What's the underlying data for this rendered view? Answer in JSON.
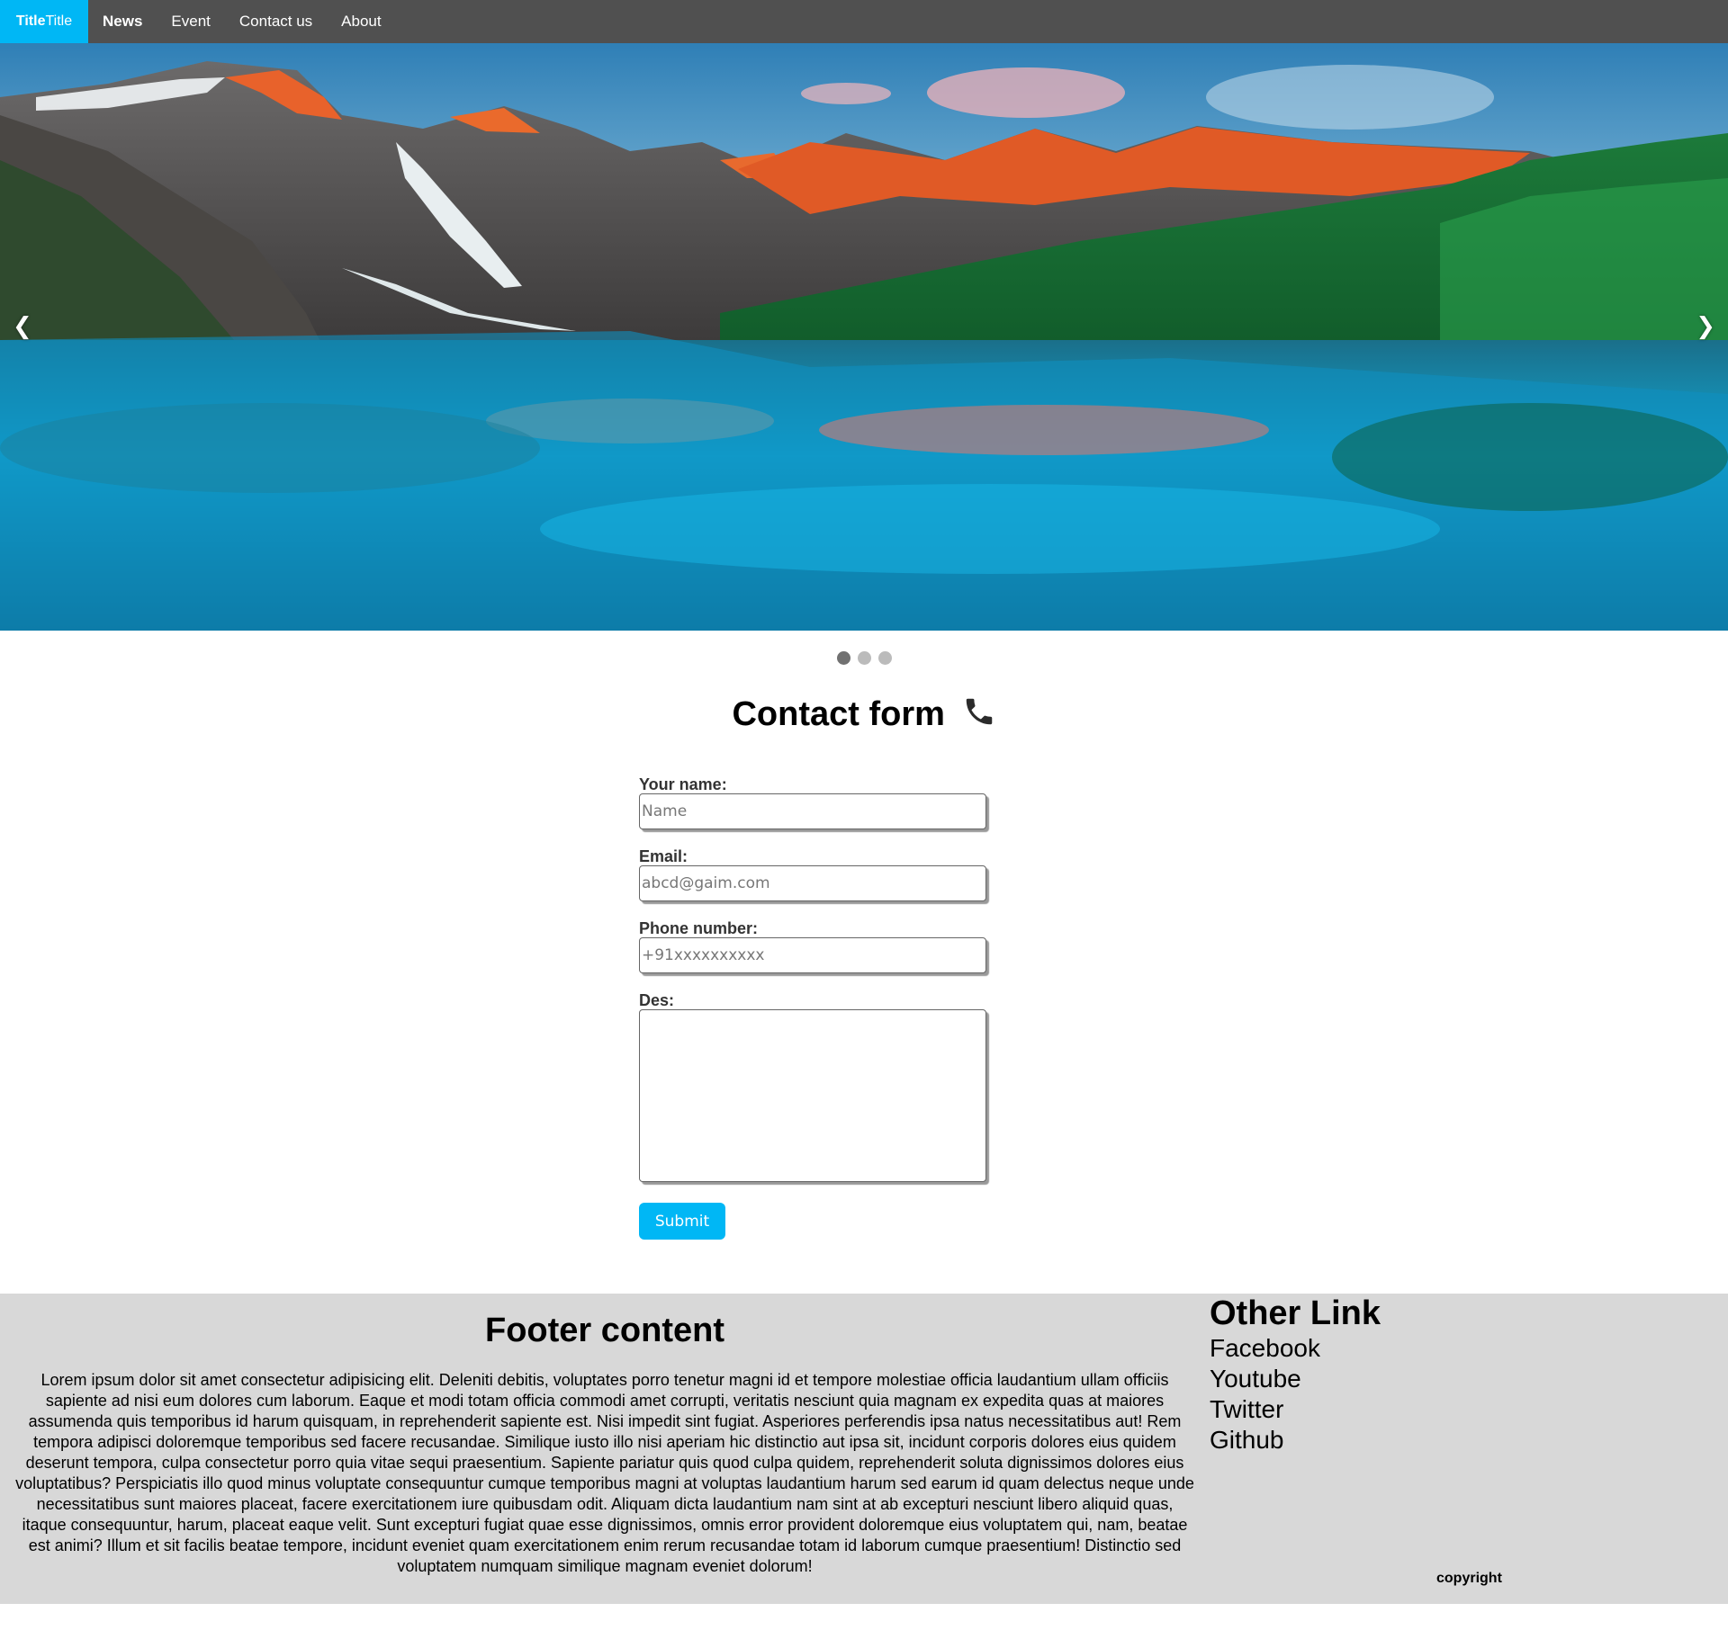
{
  "nav": {
    "brand_bold": "Title",
    "brand_rest": "Title",
    "links": [
      "News",
      "Event",
      "Contact us",
      "About"
    ],
    "active": "News"
  },
  "carousel": {
    "prev_icon": "❮",
    "next_icon": "❯",
    "slide_count": 3,
    "active_slide": 1,
    "slide_description": "mountain lake landscape"
  },
  "contact": {
    "title": "Contact form",
    "title_icon": "phone-icon",
    "name_label": "Your name:",
    "name_placeholder": "Name",
    "email_label": "Email:",
    "email_placeholder": "abcd@gaim.com",
    "phone_label": "Phone number:",
    "phone_placeholder": "+91xxxxxxxxxx",
    "des_label": "Des:",
    "submit_label": "Submit"
  },
  "footer": {
    "title": "Footer content",
    "text": "Lorem ipsum dolor sit amet consectetur adipisicing elit. Deleniti debitis, voluptates porro tenetur magni id et tempore molestiae officia laudantium ullam officiis sapiente ad nisi eum dolores cum laborum. Eaque et modi totam officia commodi amet corrupti, veritatis nesciunt quia magnam ex expedita quas at maiores assumenda quis temporibus id harum quisquam, in reprehenderit sapiente est. Nisi impedit sint fugiat. Asperiores perferendis ipsa natus necessitatibus aut! Rem tempora adipisci doloremque temporibus sed facere recusandae. Similique iusto illo nisi aperiam hic distinctio aut ipsa sit, incidunt corporis dolores eius quidem deserunt tempora, culpa consectetur porro quia vitae sequi praesentium. Sapiente pariatur quis quod culpa quidem, reprehenderit soluta dignissimos dolores eius voluptatibus? Perspiciatis illo quod minus voluptate consequuntur cumque temporibus magni at voluptas laudantium harum sed earum id quam delectus neque unde necessitatibus sunt maiores placeat, facere exercitationem iure quibusdam odit. Aliquam dicta laudantium nam sint at ab excepturi nesciunt libero aliquid quas, itaque consequuntur, harum, placeat eaque velit. Sunt excepturi fugiat quae esse dignissimos, omnis error provident doloremque eius voluptatem qui, nam, beatae est animi? Illum et sit facilis beatae tempore, incidunt eveniet quam exercitationem enim rerum recusandae totam id laborum cumque praesentium! Distinctio sed voluptatem numquam similique magnam eveniet dolorum!",
    "other_title": "Other Link",
    "links": [
      "Facebook",
      "Youtube",
      "Twitter",
      "Github"
    ],
    "copyright": "copyright"
  },
  "colors": {
    "nav_bg": "#505050",
    "accent": "#00b7f5",
    "footer_bg": "#d8d8d8"
  }
}
